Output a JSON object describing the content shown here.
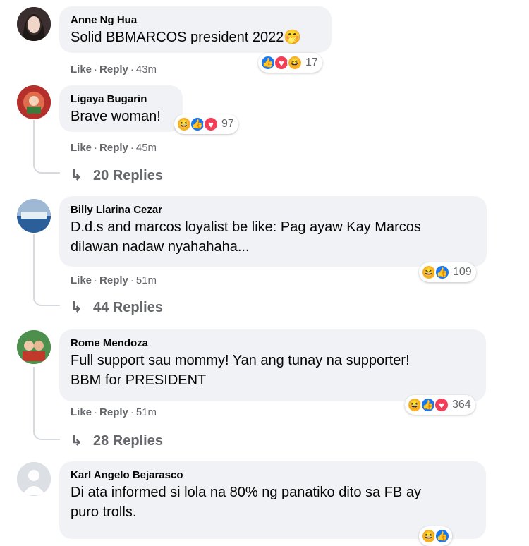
{
  "comments": [
    {
      "author": "Anne Ng Hua",
      "text": "Solid BBMARCOS president 2022🤭",
      "like": "Like",
      "reply": "Reply",
      "time": "43m",
      "reactions": [
        "like",
        "love",
        "haha"
      ],
      "reaction_count": "17",
      "replies": ""
    },
    {
      "author": "Ligaya Bugarin",
      "text": "Brave woman!",
      "like": "Like",
      "reply": "Reply",
      "time": "45m",
      "reactions": [
        "haha",
        "like",
        "love"
      ],
      "reaction_count": "97",
      "replies": "20 Replies"
    },
    {
      "author": "Billy Llarina Cezar",
      "text_line1": "D.d.s and marcos loyalist be like: Pag ayaw Kay Marcos",
      "text_line2": "dilawan nadaw nyahahaha...",
      "like": "Like",
      "reply": "Reply",
      "time": "51m",
      "reactions": [
        "haha",
        "like"
      ],
      "reaction_count": "109",
      "replies": "44 Replies"
    },
    {
      "author": "Rome Mendoza",
      "text_line1": "Full support sau mommy! Yan ang tunay na supporter!",
      "text_line2": "BBM for PRESIDENT",
      "like": "Like",
      "reply": "Reply",
      "time": "51m",
      "reactions": [
        "haha",
        "like",
        "love"
      ],
      "reaction_count": "364",
      "replies": "28 Replies"
    },
    {
      "author": "Karl Angelo Bejarasco",
      "text_line1": "Di ata informed si lola na 80% ng panatiko dito sa FB ay",
      "text_line2": "puro trolls.",
      "reactions": [
        "haha",
        "like"
      ]
    }
  ],
  "colors": {
    "bubble": "#f0f2f5",
    "meta": "#65676b",
    "like": "#1877f2",
    "love": "#f33e58",
    "haha": "#f7b125"
  }
}
